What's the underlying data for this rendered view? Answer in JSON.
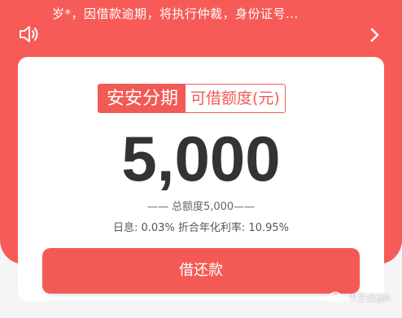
{
  "notice": {
    "text": "岁*，因借款逾期，将执行仲裁，身份证号..."
  },
  "card": {
    "product_name": "安安分期",
    "limit_label": "可借额度(元)",
    "amount": "5,000",
    "total_line": "—— 总额度5,000——",
    "rate_line": "日息: 0.03% 折合年化利率: 10.95%"
  },
  "button": {
    "label": "借还款"
  },
  "watermark": {
    "text": "卡界揭秘A"
  },
  "colors": {
    "brand_red": "#f75b57",
    "text_dark": "#333333"
  },
  "icons": {
    "speaker": "speaker-icon",
    "chevron": "chevron-right-icon",
    "wechat": "wechat-icon"
  }
}
